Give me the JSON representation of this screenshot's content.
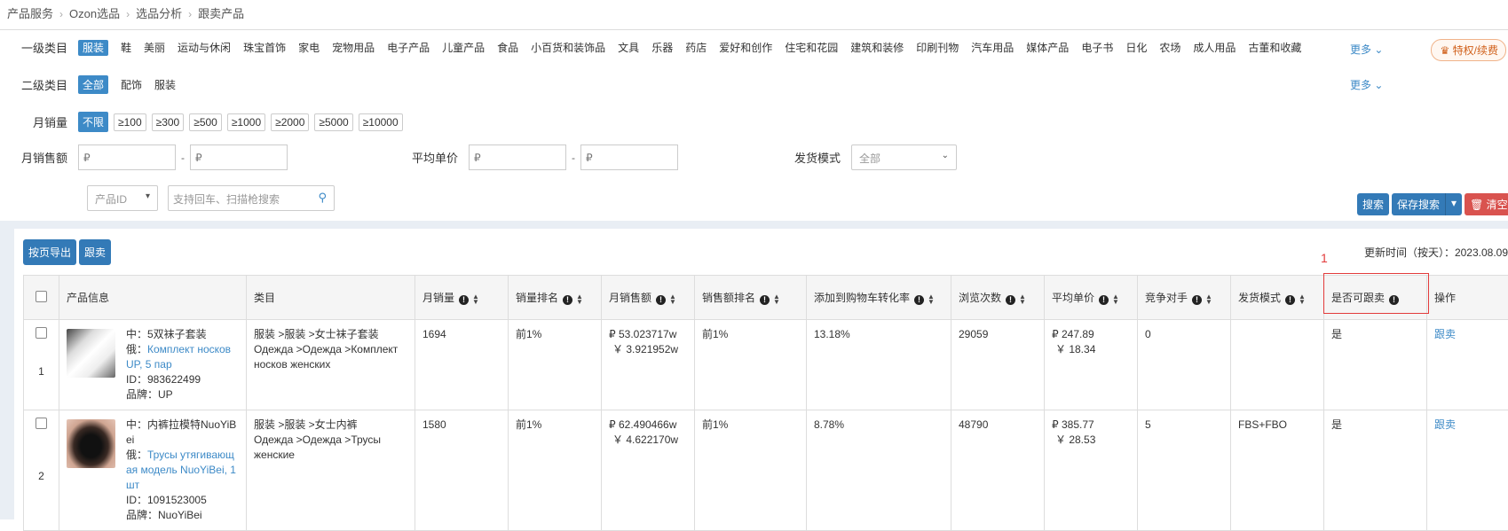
{
  "breadcrumb": [
    "产品服务",
    "Ozon选品",
    "选品分析",
    "跟卖产品"
  ],
  "filters": {
    "cat1": {
      "label": "一级类目",
      "items": [
        "服装",
        "鞋",
        "美丽",
        "运动与休闲",
        "珠宝首饰",
        "家电",
        "宠物用品",
        "电子产品",
        "儿童产品",
        "食品",
        "小百货和装饰品",
        "文具",
        "乐器",
        "药店",
        "爱好和创作",
        "住宅和花园",
        "建筑和装修",
        "印刷刊物",
        "汽车用品",
        "媒体产品",
        "电子书",
        "日化",
        "农场",
        "成人用品",
        "古董和收藏"
      ],
      "more": "更多"
    },
    "vip_label": "特权/续费",
    "cat2": {
      "label": "二级类目",
      "items": [
        "全部",
        "配饰",
        "服装"
      ],
      "more": "更多"
    },
    "sales": {
      "label": "月销量",
      "items": [
        "不限",
        "≥100",
        "≥300",
        "≥500",
        "≥1000",
        "≥2000",
        "≥5000",
        "≥10000"
      ]
    },
    "revenue": {
      "label": "月销售额",
      "from_placeholder": "₽",
      "to_placeholder": "₽"
    },
    "avg_price": {
      "label": "平均单价",
      "from_placeholder": "₽",
      "to_placeholder": "₽"
    },
    "ship_mode": {
      "label": "发货模式",
      "value": "全部"
    },
    "search_type": "产品ID",
    "search_placeholder": "支持回车、扫描枪搜索",
    "search_btn": "搜索",
    "save_search_btn": "保存搜索",
    "clear_btn": "清空"
  },
  "toolbar": {
    "export_btn": "按页导出",
    "follow_btn": "跟卖"
  },
  "update_time": "更新时间（按天）：2023.08.09",
  "annotation": "1",
  "table": {
    "headers": {
      "product": "产品信息",
      "category": "类目",
      "monthly_sales": "月销量",
      "sales_rank": "销量排名",
      "monthly_revenue": "月销售额",
      "revenue_rank": "销售额排名",
      "cart_rate": "添加到购物车转化率",
      "views": "浏览次数",
      "avg_price": "平均单价",
      "competitors": "竞争对手",
      "ship_mode": "发货模式",
      "can_follow": "是否可跟卖",
      "action": "操作"
    },
    "rows": [
      {
        "num": "1",
        "zh": "中：5双袜子套装",
        "ru_prefix": "俄：",
        "ru": "Комплект носков UP, 5 пар",
        "id": "ID：983622499",
        "brand": "品牌：UP",
        "cat_zh": "服装 >服装 >女士袜子套装",
        "cat_ru": "Одежда >Одежда >Комплект носков женских",
        "sales": "1694",
        "sales_rank": "前1%",
        "rev_rub": "₽ 53.023717w",
        "rev_cny": "￥ 3.921952w",
        "rev_rank": "前1%",
        "cart_rate": "13.18%",
        "views": "29059",
        "price_rub": "₽ 247.89",
        "price_cny": "￥ 18.34",
        "competitors": "0",
        "ship": "",
        "can_follow": "是",
        "action": "跟卖"
      },
      {
        "num": "2",
        "zh": "中：内裤拉模特NuoYiBei",
        "ru_prefix": "俄：",
        "ru": "Трусы утягивающая модель NuoYiBei, 1 шт",
        "id": "ID：1091523005",
        "brand": "品牌：NuoYiBei",
        "cat_zh": "服装 >服装 >女士内裤",
        "cat_ru": "Одежда >Одежда >Трусы женские",
        "sales": "1580",
        "sales_rank": "前1%",
        "rev_rub": "₽ 62.490466w",
        "rev_cny": "￥ 4.622170w",
        "rev_rank": "前1%",
        "cart_rate": "8.78%",
        "views": "48790",
        "price_rub": "₽ 385.77",
        "price_cny": "￥ 28.53",
        "competitors": "5",
        "ship": "FBS+FBO",
        "can_follow": "是",
        "action": "跟卖"
      }
    ]
  }
}
